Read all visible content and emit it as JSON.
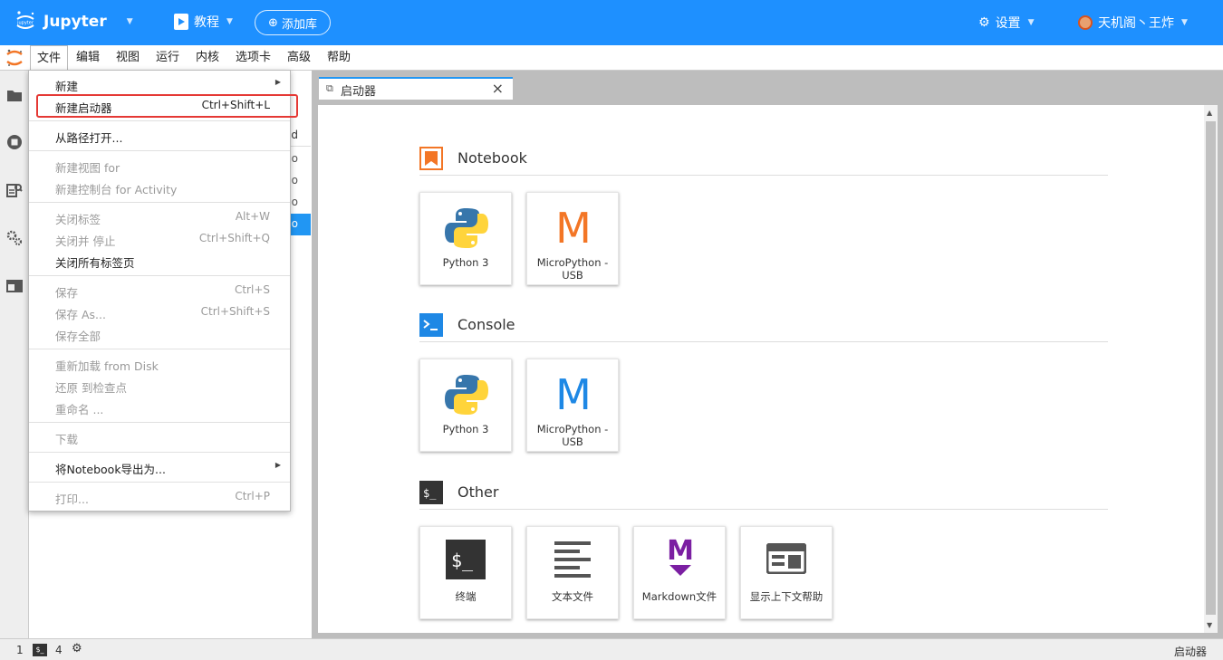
{
  "header": {
    "brand": "Jupyter",
    "tutorial": "教程",
    "add_library": "添加库",
    "settings": "设置",
    "user": "天机阁丶王炸"
  },
  "menubar": [
    "文件",
    "编辑",
    "视图",
    "运行",
    "内核",
    "选项卡",
    "高级",
    "帮助"
  ],
  "file_menu": {
    "new": "新建",
    "new_launcher": "新建启动器",
    "new_launcher_shortcut": "Ctrl+Shift+L",
    "open_from_path": "从路径打开...",
    "new_view": "新建视图 for",
    "new_console": "新建控制台 for Activity",
    "close_tab": "关闭标签",
    "close_tab_shortcut": "Alt+W",
    "close_and_stop": "关闭并 停止",
    "close_and_stop_shortcut": "Ctrl+Shift+Q",
    "close_all": "关闭所有标签页",
    "save": "保存",
    "save_shortcut": "Ctrl+S",
    "save_as": "保存 As...",
    "save_as_shortcut": "Ctrl+Shift+S",
    "save_all": "保存全部",
    "reload": "重新加载 from Disk",
    "revert": "还原 到检查点",
    "rename": "重命名 ...",
    "download": "下载",
    "export": "将Notebook导出为...",
    "print": "打印...",
    "print_shortcut": "Ctrl+P"
  },
  "filebrowser": {
    "header_partial": "ed",
    "row_partial": "go"
  },
  "tab": {
    "label": "启动器"
  },
  "launcher": {
    "notebook": {
      "title": "Notebook",
      "cards": [
        "Python 3",
        "MicroPython - USB"
      ]
    },
    "console": {
      "title": "Console",
      "cards": [
        "Python 3",
        "MicroPython - USB"
      ]
    },
    "other": {
      "title": "Other",
      "cards": [
        "终端",
        "文本文件",
        "Markdown文件",
        "显示上下文帮助"
      ]
    }
  },
  "statusbar": {
    "count1": "1",
    "count2": "4",
    "right": "启动器"
  },
  "colors": {
    "header": "#1e90ff",
    "accent": "#2196f3",
    "highlight": "#e53935",
    "micropython_orange": "#f37626",
    "micropython_blue": "#1e88e5",
    "markdown_purple": "#7b1fa2"
  }
}
